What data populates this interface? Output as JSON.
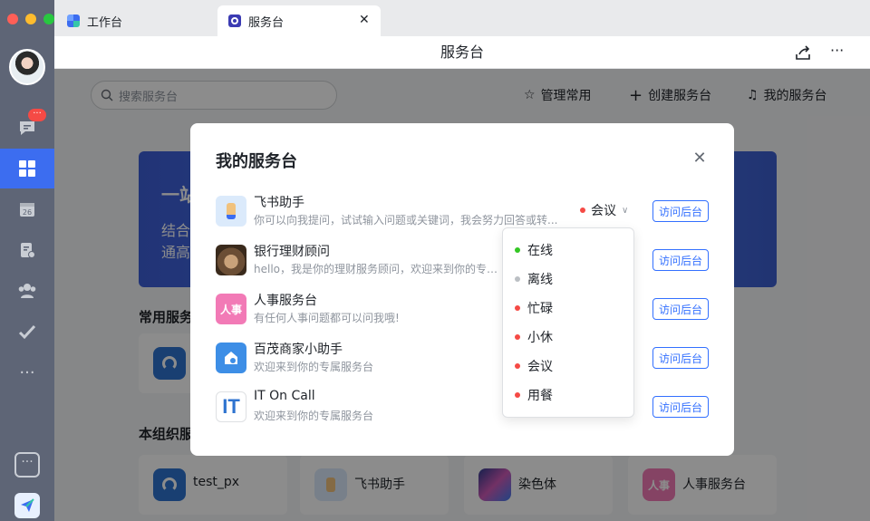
{
  "window": {
    "controls": [
      "close",
      "minimize",
      "maximize"
    ]
  },
  "tabs": [
    {
      "label": "工作台",
      "icon": "grid-icon",
      "active": false
    },
    {
      "label": "服务台",
      "icon": "service-desk-icon",
      "active": true
    }
  ],
  "tab_close_icon": "close-icon",
  "header": {
    "title": "服务台"
  },
  "rail": {
    "badge": "···"
  },
  "main": {
    "search_placeholder": "搜索服务台",
    "toolbar": {
      "manage": "管理常用",
      "create": "创建服务台",
      "mine": "我的服务台"
    },
    "banner": {
      "title": "一站",
      "line1": "结合",
      "line2": "通高"
    },
    "section_common": "常用服务",
    "section_org": "本组织服",
    "org_cards": [
      {
        "label": "test_px",
        "icon": "headset-icon"
      },
      {
        "label": "飞书助手",
        "icon": "assistant-icon"
      },
      {
        "label": "染色体",
        "icon": "chromosome-icon"
      },
      {
        "label": "人事服务台",
        "icon": "hr-icon",
        "icon_text": "人事"
      }
    ]
  },
  "modal": {
    "title": "我的服务台",
    "items": [
      {
        "name": "飞书助手",
        "desc": "你可以向我提问，试试输入问题或关键词，我会努力回答或转...",
        "action": "访问后台",
        "status": "会议",
        "icon_text": ""
      },
      {
        "name": "银行理财顾问",
        "desc": "hello，我是你的理财服务顾问，欢迎来到你的专属服",
        "action": "访问后台",
        "icon_text": ""
      },
      {
        "name": "人事服务台",
        "desc": "有任何人事问题都可以问我哦!",
        "action": "访问后台",
        "icon_text": "人事"
      },
      {
        "name": "百茂商家小助手",
        "desc": "欢迎来到你的专属服务台",
        "action": "访问后台",
        "icon_text": ""
      },
      {
        "name": "IT On Call",
        "desc": "欢迎来到你的专属服务台",
        "action": "访问后台",
        "icon_text": "IT"
      }
    ]
  },
  "status_options": [
    {
      "label": "在线",
      "color": "#34c724"
    },
    {
      "label": "离线",
      "color": "#bbbfc4"
    },
    {
      "label": "忙碌",
      "color": "#f54a45"
    },
    {
      "label": "小休",
      "color": "#f54a45"
    },
    {
      "label": "会议",
      "color": "#f54a45"
    },
    {
      "label": "用餐",
      "color": "#f54a45"
    }
  ],
  "colors": {
    "accent": "#3370ff",
    "rail": "#5e6576",
    "rail_active": "#3c6df0"
  }
}
